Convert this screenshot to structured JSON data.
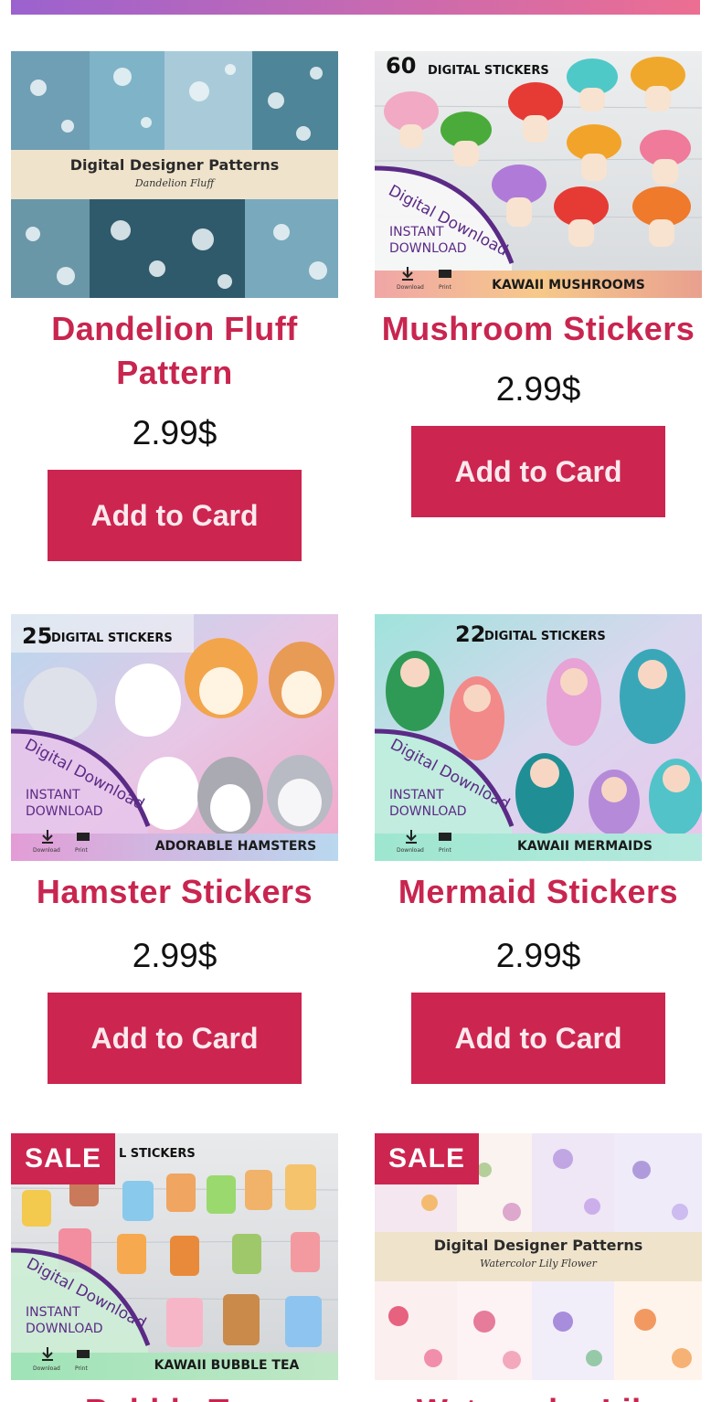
{
  "products": [
    {
      "title": "Dandelion Fluff Pattern",
      "price": "2.99$",
      "button": "Add to Card",
      "image": {
        "banner_title": "Digital Designer Patterns",
        "banner_subtitle": "Dandelion Fluff"
      }
    },
    {
      "title": "Mushroom Stickers",
      "price": "2.99$",
      "button": "Add to Card",
      "image": {
        "count": "60",
        "count_label": "DIGITAL STICKERS",
        "ribbon": "Digital Download",
        "instant": "INSTANT",
        "download": "DOWNLOAD",
        "dl_label": "Download",
        "print_label": "Print",
        "footer": "KAWAII MUSHROOMS"
      }
    },
    {
      "title": "Hamster Stickers",
      "price": "2.99$",
      "button": "Add to Card",
      "image": {
        "count": "25",
        "count_label": "DIGITAL STICKERS",
        "ribbon": "Digital Download",
        "instant": "INSTANT",
        "download": "DOWNLOAD",
        "dl_label": "Download",
        "print_label": "Print",
        "footer": "ADORABLE HAMSTERS"
      }
    },
    {
      "title": "Mermaid Stickers",
      "price": "2.99$",
      "button": "Add to Card",
      "image": {
        "count": "22",
        "count_label": "DIGITAL STICKERS",
        "ribbon": "Digital Download",
        "instant": "INSTANT",
        "download": "DOWNLOAD",
        "dl_label": "Download",
        "print_label": "Print",
        "footer": "KAWAII MERMAIDS"
      }
    },
    {
      "title": "Bubble Tea",
      "sale": "SALE",
      "image": {
        "count_label": "L STICKERS",
        "ribbon": "Digital Download",
        "instant": "INSTANT",
        "download": "DOWNLOAD",
        "dl_label": "Download",
        "print_label": "Print",
        "footer": "KAWAII BUBBLE TEA"
      }
    },
    {
      "title": "Watercolor Lily",
      "sale": "SALE",
      "image": {
        "banner_title": "Digital Designer Patterns",
        "banner_subtitle": "Watercolor Lily Flower"
      }
    }
  ],
  "colors": {
    "accent": "#cc2550",
    "title": "#c8254f",
    "ribbon": "#5b2a86"
  }
}
